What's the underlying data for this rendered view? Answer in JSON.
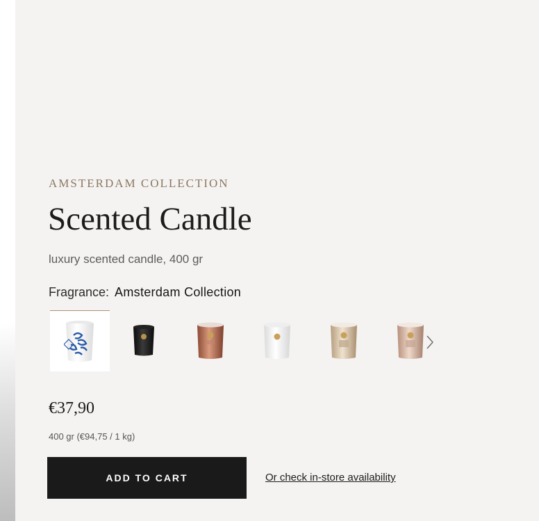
{
  "product": {
    "collection": "AMSTERDAM COLLECTION",
    "title": "Scented Candle",
    "subtitle": "luxury scented candle, 400 gr"
  },
  "fragrance": {
    "label": "Fragrance:",
    "value": "Amsterdam Collection",
    "swatches": [
      {
        "name": "Amsterdam Collection",
        "icon": "white-blue-delft-candle",
        "color": "#ffffff",
        "selected": true
      },
      {
        "name": "black candle",
        "icon": "black-candle",
        "color": "#1c1c1c",
        "selected": false
      },
      {
        "name": "copper candle",
        "icon": "copper-candle",
        "color": "#b4745a",
        "selected": false
      },
      {
        "name": "white candle",
        "icon": "white-candle",
        "color": "#f4f4f4",
        "selected": false
      },
      {
        "name": "champagne candle",
        "icon": "champagne-candle",
        "color": "#d8c0a4",
        "selected": false
      },
      {
        "name": "rose gold candle",
        "icon": "rose-gold-candle",
        "color": "#d4b29e",
        "selected": false
      }
    ],
    "next_icon": "chevron-right-icon"
  },
  "pricing": {
    "price": "€37,90",
    "unit_price": "400 gr (€94,75 / 1 kg)"
  },
  "actions": {
    "add_to_cart": "ADD TO CART",
    "store_availability": "Or check in-store availability"
  }
}
